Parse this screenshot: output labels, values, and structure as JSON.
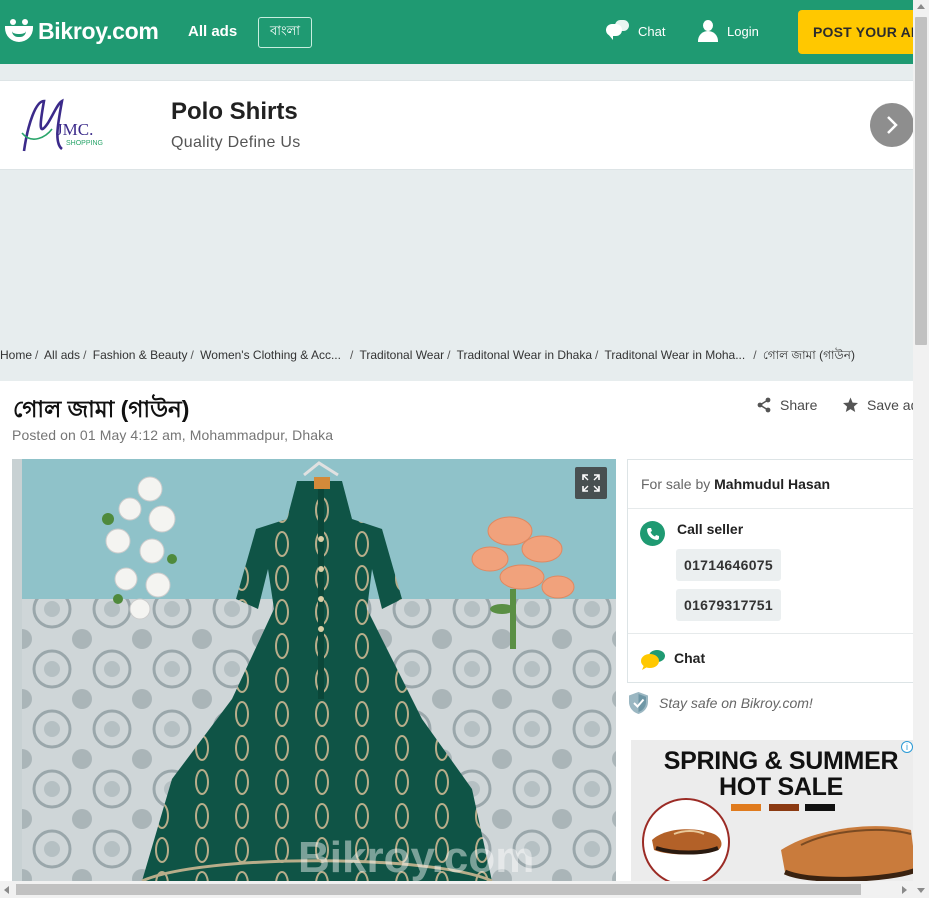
{
  "header": {
    "logo_text": "Bikroy.com",
    "all_ads": "All ads",
    "language": "বাংলা",
    "chat": "Chat",
    "login": "Login",
    "post_ad": "POST YOUR AD",
    "accent_color": "#1f9a72",
    "post_color": "#ffc800"
  },
  "shop": {
    "logo_text": "JMC.",
    "logo_sub": "SHOPPING",
    "title": "Polo Shirts",
    "subtitle": "Quality Define Us"
  },
  "breadcrumb": [
    "Home",
    "All ads",
    "Fashion & Beauty",
    "Women's Clothing & Acc...",
    "Traditonal Wear",
    "Traditonal Wear in Dhaka",
    "Traditonal Wear in Moha...",
    "গোল জামা (গাউন)"
  ],
  "ad": {
    "title": "গোল জামা (গাউন)",
    "posted": "Posted on 01 May 4:12 am, Mohammadpur, Dhaka",
    "share": "Share",
    "save": "Save ad",
    "watermark": "Bikroy.com"
  },
  "seller": {
    "prefix": "For sale by",
    "name": "Mahmudul Hasan",
    "call_label": "Call seller",
    "phones": [
      "01714646075",
      "01679317751"
    ],
    "chat_label": "Chat"
  },
  "safety": "Stay safe on Bikroy.com!",
  "promo": {
    "line1": "SPRING & SUMMER",
    "line2": "HOT SALE",
    "info_icon": "i",
    "swatches": [
      "#e07b1e",
      "#8b3a12",
      "#111111"
    ]
  }
}
